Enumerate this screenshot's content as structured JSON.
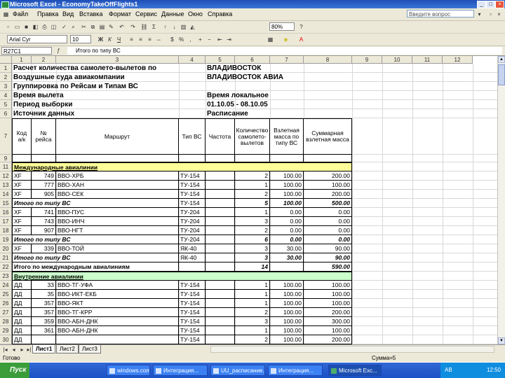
{
  "window": {
    "title": "Microsoft Excel - EconomyTakeOffFlights1"
  },
  "menu": [
    "Файл",
    "Правка",
    "Вид",
    "Вставка",
    "Формат",
    "Сервис",
    "Данные",
    "Окно",
    "Справка"
  ],
  "ask_box": "Введите вопрос",
  "toolbar": {
    "font": "Arial Cyr",
    "size": "10",
    "zoom": "80%"
  },
  "formula_bar": {
    "name_box": "R27C1",
    "value": "Итого по типу ВС"
  },
  "columns": [
    "1",
    "2",
    "3",
    "4",
    "5",
    "6",
    "7",
    "8",
    "9",
    "10",
    "11",
    "12"
  ],
  "header_rows": [
    {
      "row": "1",
      "a": "Расчет количества самолето-вылетов по",
      "e": "ВЛАДИВОСТОК"
    },
    {
      "row": "2",
      "a": "Воздушные суда авиакомпании",
      "e": "ВЛАДИВОСТОК АВИА"
    },
    {
      "row": "3",
      "a": "Группировка по Рейсам и Типам ВС",
      "e": ""
    },
    {
      "row": "4",
      "a": "Время вылета",
      "e": "Время локальное"
    },
    {
      "row": "5",
      "a": "Период выборки",
      "e": "01.10.05 - 08.10.05"
    },
    {
      "row": "6",
      "a": "Источник данных",
      "e": "Расписание"
    }
  ],
  "table_header": {
    "row": "7",
    "c1": "Код а/к",
    "c2": "№ рейса",
    "c3": "Маршрут",
    "c4": "Тип ВС",
    "c5": "Частота",
    "c6": "Количество самолето-вылетов",
    "c7": "Взлетная масса по типу ВС",
    "c8": "Суммарная взлетная масса"
  },
  "row_after_header": "9",
  "intl_section": {
    "row": "11",
    "label": "Международные авиалинии"
  },
  "intl_rows": [
    {
      "row": "12",
      "c1": "XF",
      "c2": "749",
      "c3": "ВВО-ХРБ",
      "c4": "ТУ-154",
      "c6": "2",
      "c7": "100.00",
      "c8": "200.00",
      "style": "data"
    },
    {
      "row": "13",
      "c1": "XF",
      "c2": "777",
      "c3": "ВВО-ХАН",
      "c4": "ТУ-154",
      "c6": "1",
      "c7": "100.00",
      "c8": "100.00",
      "style": "data"
    },
    {
      "row": "14",
      "c1": "XF",
      "c2": "905",
      "c3": "ВВО-СЕК",
      "c4": "ТУ-154",
      "c6": "2",
      "c7": "100.00",
      "c8": "200.00",
      "style": "data"
    },
    {
      "row": "15",
      "c1": "Итого по типу ВС",
      "c2": "",
      "c3": "",
      "c4": "ТУ-154",
      "c6": "5",
      "c7": "100.00",
      "c8": "500.00",
      "style": "subtotal"
    },
    {
      "row": "16",
      "c1": "XF",
      "c2": "741",
      "c3": "ВВО-ПУС",
      "c4": "ТУ-204",
      "c6": "1",
      "c7": "0.00",
      "c8": "0.00",
      "style": "data"
    },
    {
      "row": "17",
      "c1": "XF",
      "c2": "743",
      "c3": "ВВО-ИНЧ",
      "c4": "ТУ-204",
      "c6": "3",
      "c7": "0.00",
      "c8": "0.00",
      "style": "data"
    },
    {
      "row": "18",
      "c1": "XF",
      "c2": "907",
      "c3": "ВВО-НГТ",
      "c4": "ТУ-204",
      "c6": "2",
      "c7": "0.00",
      "c8": "0.00",
      "style": "data"
    },
    {
      "row": "19",
      "c1": "Итого по типу ВС",
      "c2": "",
      "c3": "",
      "c4": "ТУ-204",
      "c6": "6",
      "c7": "0.00",
      "c8": "0.00",
      "style": "subtotal"
    },
    {
      "row": "20",
      "c1": "XF",
      "c2": "339",
      "c3": "ВВО-ТОЙ",
      "c4": "ЯК-40",
      "c6": "3",
      "c7": "30.00",
      "c8": "90.00",
      "style": "data"
    },
    {
      "row": "21",
      "c1": "Итого по типу ВС",
      "c2": "",
      "c3": "",
      "c4": "ЯК-40",
      "c6": "3",
      "c7": "30.00",
      "c8": "90.00",
      "style": "subtotal"
    },
    {
      "row": "22",
      "c1": "Итого по международным авиалиниям",
      "c2": "",
      "c3": "",
      "c4": "",
      "c6": "14",
      "c7": "",
      "c8": "590.00",
      "style": "total"
    }
  ],
  "dom_section": {
    "row": "23",
    "label": "Внутренние авиалинии"
  },
  "dom_rows": [
    {
      "row": "24",
      "c1": "ДД",
      "c2": "33",
      "c3": "ВВО-ТГ-УФА",
      "c4": "ТУ-154",
      "c6": "1",
      "c7": "100.00",
      "c8": "100.00",
      "style": "data"
    },
    {
      "row": "25",
      "c1": "ДД",
      "c2": "35",
      "c3": "ВВО-ИКТ-ЕКБ",
      "c4": "ТУ-154",
      "c6": "1",
      "c7": "100.00",
      "c8": "100.00",
      "style": "data"
    },
    {
      "row": "26",
      "c1": "ДД",
      "c2": "357",
      "c3": "ВВО-ЯКТ",
      "c4": "ТУ-154",
      "c6": "1",
      "c7": "100.00",
      "c8": "100.00",
      "style": "data"
    },
    {
      "row": "27",
      "c1": "ДД",
      "c2": "357",
      "c3": "ВВО-ТГ-КРР",
      "c4": "ТУ-154",
      "c6": "2",
      "c7": "100.00",
      "c8": "200.00",
      "style": "data"
    },
    {
      "row": "28",
      "c1": "ДД",
      "c2": "359",
      "c3": "ВВО-АБН-ДНК",
      "c4": "ТУ-154",
      "c6": "3",
      "c7": "100.00",
      "c8": "300.00",
      "style": "data"
    },
    {
      "row": "29",
      "c1": "ДД",
      "c2": "361",
      "c3": "ВВО-АБН-ДНК",
      "c4": "ТУ-154",
      "c6": "1",
      "c7": "100.00",
      "c8": "100.00",
      "style": "data"
    },
    {
      "row": "30",
      "c1": "ДД",
      "c2": "",
      "c3": "",
      "c4": "ТУ-154",
      "c6": "2",
      "c7": "100.00",
      "c8": "200.00",
      "style": "data"
    }
  ],
  "sheet_tabs": [
    "Лист1",
    "Лист2",
    "Лист3"
  ],
  "status": {
    "left": "Готово",
    "right": "Сумма=5"
  },
  "taskbar": {
    "start": "Пуск",
    "items": [
      "windows.com...",
      "Интеграция...",
      "UU_расписание...",
      "Интеграция...",
      "Microsoft Exc..."
    ],
    "lang": "АВ",
    "clock": "12:50"
  },
  "colors": {
    "intl_fill": "#ffff99",
    "dom_fill": "#ccffcc"
  }
}
